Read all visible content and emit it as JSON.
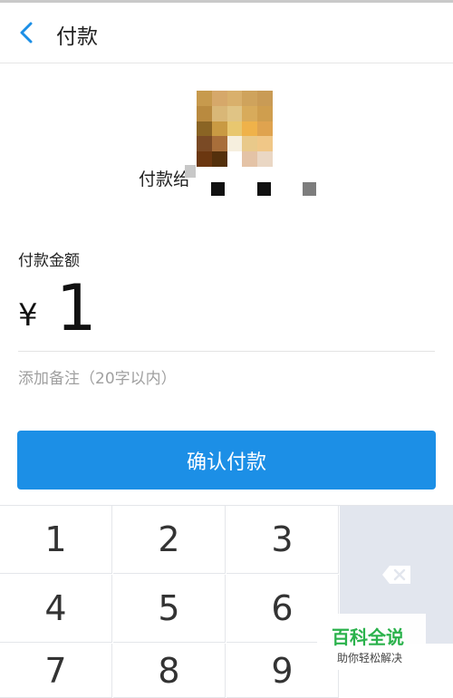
{
  "header": {
    "title": "付款"
  },
  "payee": {
    "prefix": "付款给"
  },
  "amount": {
    "label": "付款金额",
    "currency": "¥",
    "value": "1"
  },
  "remark": {
    "placeholder": "添加备注（20字以内）"
  },
  "confirm_button": {
    "label": "确认付款"
  },
  "keypad": {
    "keys": [
      "1",
      "2",
      "3",
      "4",
      "5",
      "6",
      "7",
      "8",
      "9"
    ]
  },
  "watermark": {
    "title": "百科全说",
    "subtitle": "助你轻松解决"
  },
  "colors": {
    "accent": "#1c8fe6",
    "watermark_green": "#2bb24c"
  }
}
